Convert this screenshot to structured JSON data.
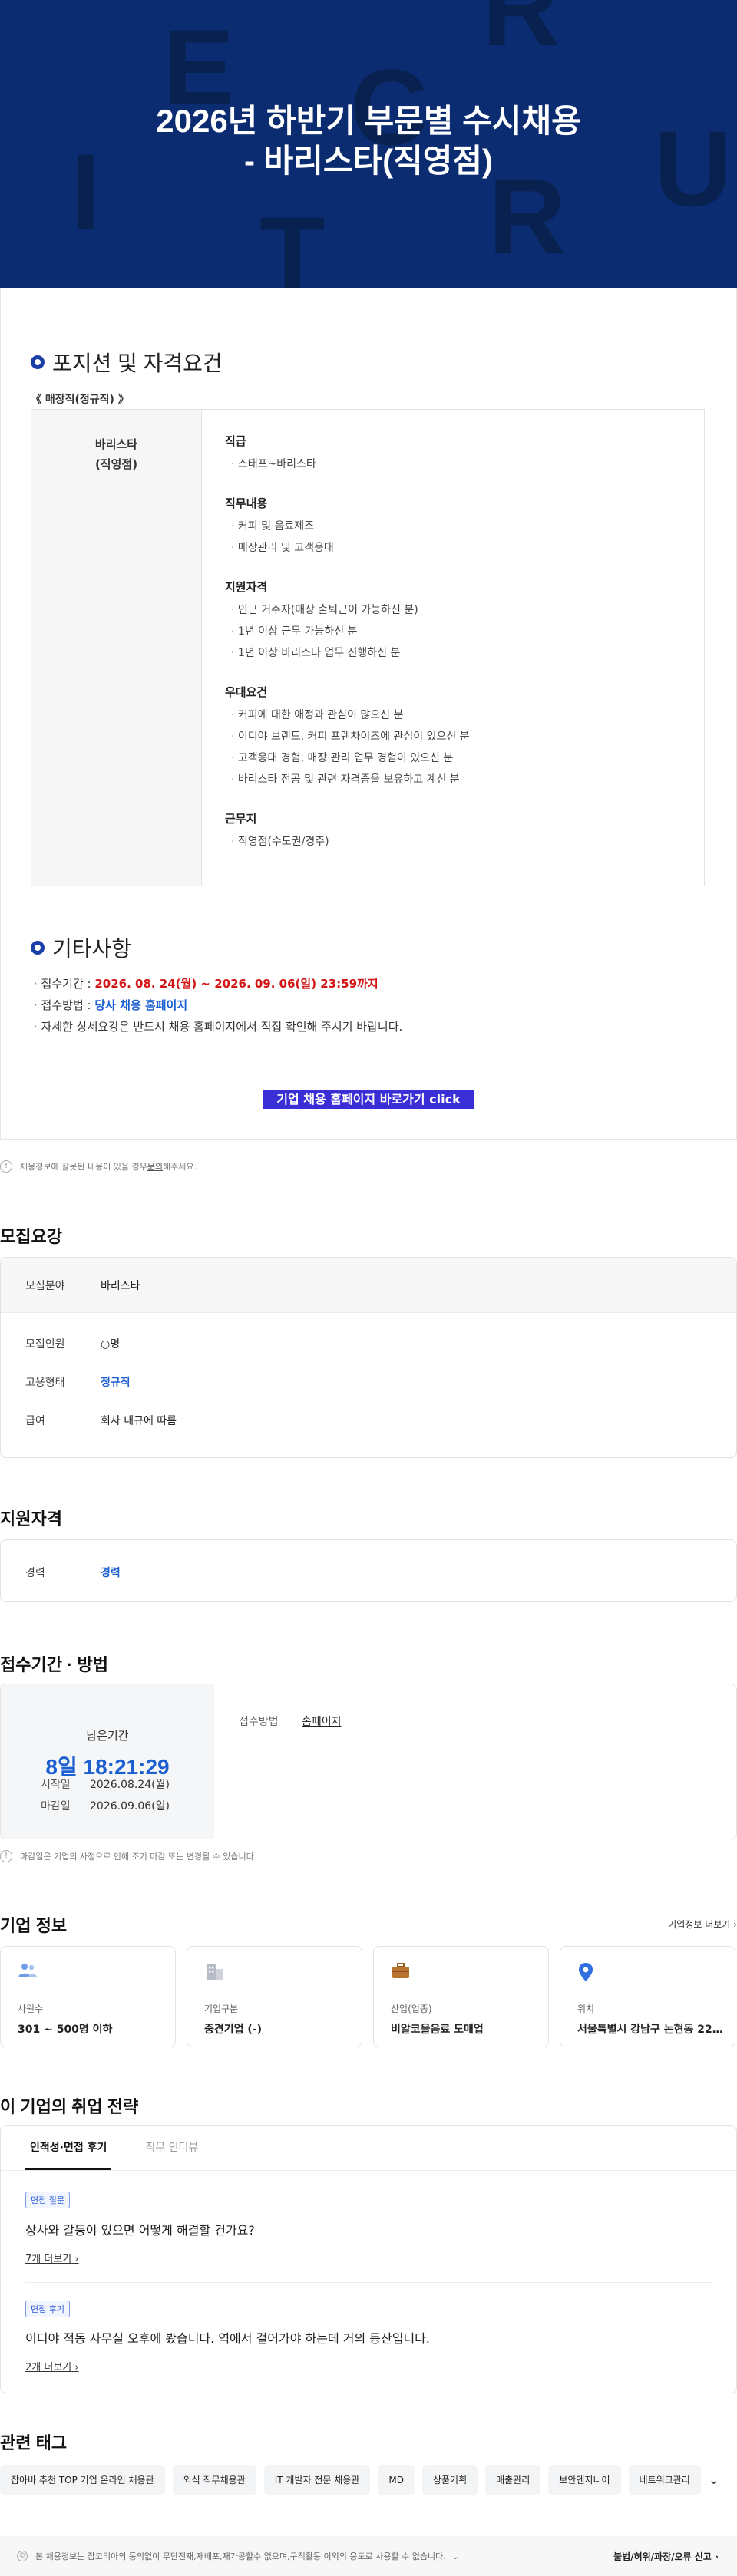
{
  "banner": {
    "title_line1": "2026년 하반기 부문별 수시채용",
    "title_line2": "- 바리스타(직영점)",
    "deco_letters": [
      "E",
      "R",
      "C",
      "U",
      "I",
      "T",
      "R"
    ]
  },
  "position": {
    "section_title": "포지션 및 자격요건",
    "category": "《 매장직(정규직) 》",
    "role_line1": "바리스타",
    "role_line2": "(직영점)",
    "groups": [
      {
        "title": "직급",
        "items": [
          "스태프~바리스타"
        ]
      },
      {
        "title": "직무내용",
        "items": [
          "커피 및 음료제조",
          "매장관리 및 고객응대"
        ]
      },
      {
        "title": "지원자격",
        "items": [
          "인근 거주자(매장 출퇴근이 가능하신 분)",
          "1년 이상 근무 가능하신 분",
          "1년 이상 바리스타 업무 진행하신 분"
        ]
      },
      {
        "title": "우대요건",
        "items": [
          "커피에 대한 애정과 관심이 많으신 분",
          "이디야 브랜드, 커피 프랜차이즈에 관심이 있으신 분",
          "고객응대 경험, 매장 관리 업무 경험이 있으신 분",
          "바리스타 전공 및 관련 자격증을 보유하고 계신 분"
        ]
      },
      {
        "title": "근무지",
        "items": [
          "직영점(수도권/경주)"
        ]
      }
    ]
  },
  "etc": {
    "section_title": "기타사항",
    "period_label": "접수기간 : ",
    "period_value": "2026. 08. 24(월) ~ 2026. 09. 06(일) 23:59까지",
    "method_label": "접수방법 : ",
    "method_value": "당사 채용 홈페이지",
    "detail": "자세한 상세요강은 반드시 채용 홈페이지에서 직접 확인해 주시기 바랍니다.",
    "cta": "기업 채용 홈페이지 바로가기 click"
  },
  "notice1": {
    "prefix": "채용정보에 잘못된 내용이 있을 경우 ",
    "link": "문의",
    "suffix": "해주세요."
  },
  "recruit": {
    "title": "모집요강",
    "field_label": "모집분야",
    "field_value": "바리스타",
    "count_label": "모집인원",
    "count_value": "○명",
    "type_label": "고용형태",
    "type_value": "정규직",
    "pay_label": "급여",
    "pay_value": "회사 내규에 따름"
  },
  "qualification": {
    "title": "지원자격",
    "career_label": "경력",
    "career_value": "경력"
  },
  "apply": {
    "title": "접수기간 · 방법",
    "remain_label": "남은기간",
    "remain_time": "8일 18:21:29",
    "start_label": "시작일",
    "start_value": "2026.08.24(월)",
    "end_label": "마감일",
    "end_value": "2026.09.06(일)",
    "method_label": "접수방법",
    "method_value": "홈페이지",
    "notice": "마감일은 기업의 사정으로 인해 조기 마감 또는 변경될 수 있습니다"
  },
  "company": {
    "title": "기업 정보",
    "more": "기업정보 더보기",
    "cards": [
      {
        "icon": "people-icon",
        "label": "사원수",
        "value": "301 ~ 500명 이하"
      },
      {
        "icon": "building-icon",
        "label": "기업구분",
        "value": "중견기업 (-)"
      },
      {
        "icon": "briefcase-icon",
        "label": "산업(업종)",
        "value": "비알코올음료 도매업"
      },
      {
        "icon": "location-pin-icon",
        "label": "위치",
        "value": "서울특별시 강남구 논현동 221-…"
      }
    ]
  },
  "strategy": {
    "title": "이 기업의 취업 전략",
    "tab_active": "인적성·면접 후기",
    "tab_inactive": "직무 인터뷰",
    "items": [
      {
        "badge": "면접 질문",
        "text": "상사와 갈등이 있으면 어떻게 해결할 건가요?",
        "more": "7개 더보기"
      },
      {
        "badge": "면접 후기",
        "text": "이디야 적동 사무실 오후에 봤습니다. 역에서 걸어가야 하는데 거의 등산입니다.",
        "more": "2개 더보기"
      }
    ]
  },
  "tags": {
    "title": "관련 태그",
    "items": [
      "잡아바 추천 TOP 기업 온라인 채용관",
      "외식 직무채용관",
      "IT 개발자 전문 채용관",
      "MD",
      "상품기획",
      "매출관리",
      "보안엔지니어",
      "네트워크관리"
    ]
  },
  "footer": {
    "note": "본 채용정보는 잡코리아의 동의없이 무단전재,재배포,재가공할수 없으며,구직활동 이외의 용도로 사용할 수 없습니다.",
    "report": "불법/허위/과장/오류 신고"
  }
}
